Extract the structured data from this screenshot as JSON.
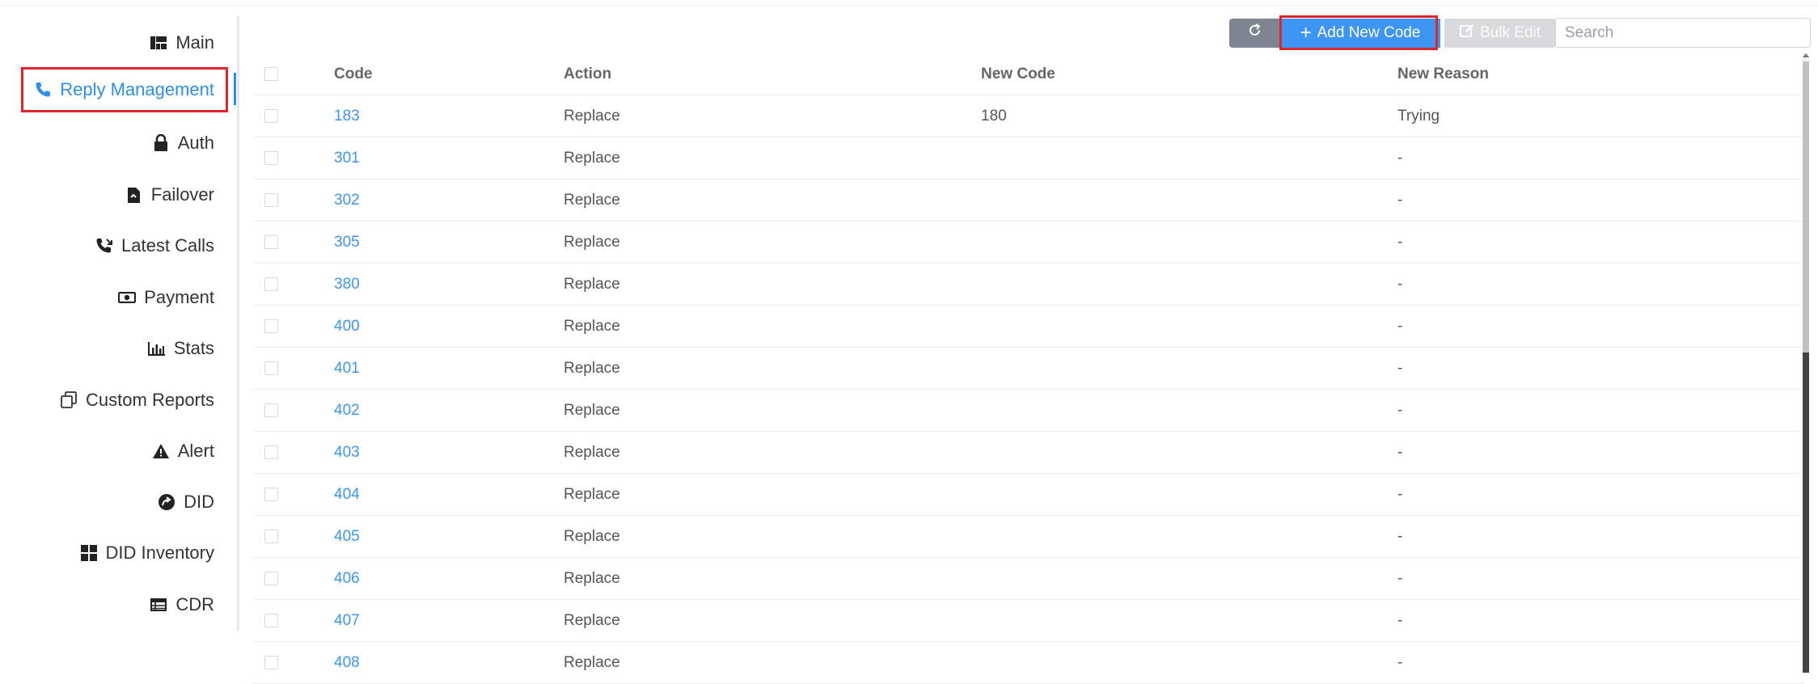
{
  "sidebar": {
    "items": [
      {
        "label": "Main",
        "icon": "dashboard-icon"
      },
      {
        "label": "Reply Management",
        "icon": "phone-icon",
        "active": true
      },
      {
        "label": "Auth",
        "icon": "lock-icon"
      },
      {
        "label": "Failover",
        "icon": "file-icon"
      },
      {
        "label": "Latest Calls",
        "icon": "phone-log-icon"
      },
      {
        "label": "Payment",
        "icon": "money-icon"
      },
      {
        "label": "Stats",
        "icon": "bar-chart-icon"
      },
      {
        "label": "Custom Reports",
        "icon": "copy-icon"
      },
      {
        "label": "Alert",
        "icon": "warning-icon"
      },
      {
        "label": "DID",
        "icon": "arrow-circle-icon"
      },
      {
        "label": "DID Inventory",
        "icon": "grid-icon"
      },
      {
        "label": "CDR",
        "icon": "table-icon"
      }
    ],
    "accent_color": "#2e8fe8"
  },
  "toolbar": {
    "refresh_icon": "refresh-icon",
    "add_label": "Add New Code",
    "bulk_edit_label": "Bulk Edit",
    "search_placeholder": "Search"
  },
  "table": {
    "columns": {
      "code": "Code",
      "action": "Action",
      "new_code": "New Code",
      "new_reason": "New Reason"
    },
    "rows": [
      {
        "code": "183",
        "action": "Replace",
        "new_code": "180",
        "new_reason": "Trying"
      },
      {
        "code": "301",
        "action": "Replace",
        "new_code": "",
        "new_reason": "-"
      },
      {
        "code": "302",
        "action": "Replace",
        "new_code": "",
        "new_reason": "-"
      },
      {
        "code": "305",
        "action": "Replace",
        "new_code": "",
        "new_reason": "-"
      },
      {
        "code": "380",
        "action": "Replace",
        "new_code": "",
        "new_reason": "-"
      },
      {
        "code": "400",
        "action": "Replace",
        "new_code": "",
        "new_reason": "-"
      },
      {
        "code": "401",
        "action": "Replace",
        "new_code": "",
        "new_reason": "-"
      },
      {
        "code": "402",
        "action": "Replace",
        "new_code": "",
        "new_reason": "-"
      },
      {
        "code": "403",
        "action": "Replace",
        "new_code": "",
        "new_reason": "-"
      },
      {
        "code": "404",
        "action": "Replace",
        "new_code": "",
        "new_reason": "-"
      },
      {
        "code": "405",
        "action": "Replace",
        "new_code": "",
        "new_reason": "-"
      },
      {
        "code": "406",
        "action": "Replace",
        "new_code": "",
        "new_reason": "-"
      },
      {
        "code": "407",
        "action": "Replace",
        "new_code": "",
        "new_reason": "-"
      },
      {
        "code": "408",
        "action": "Replace",
        "new_code": "",
        "new_reason": "-"
      }
    ]
  },
  "colors": {
    "link": "#3d95f5",
    "primary_button": "#3d95f5",
    "highlight_box": "#e0262b"
  }
}
